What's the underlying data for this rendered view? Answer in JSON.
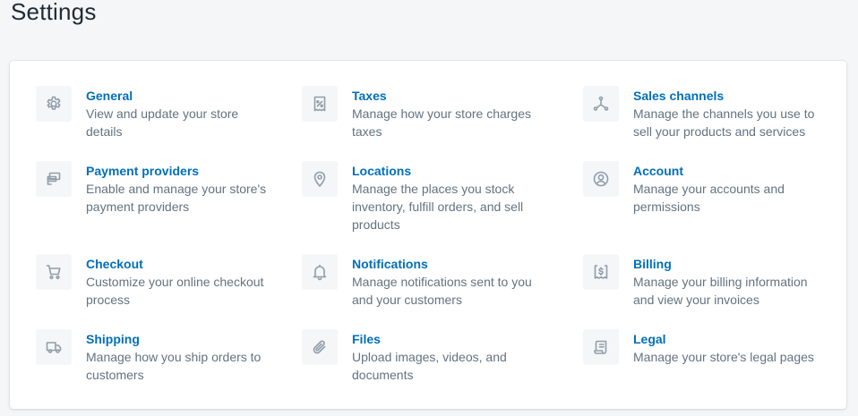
{
  "page": {
    "title": "Settings"
  },
  "settings": {
    "general": {
      "title": "General",
      "description": "View and update your store details",
      "icon": "gear-icon"
    },
    "taxes": {
      "title": "Taxes",
      "description": "Manage how your store charges taxes",
      "icon": "tax-icon"
    },
    "sales_channels": {
      "title": "Sales channels",
      "description": "Manage the channels you use to sell your products and services",
      "icon": "sales-channels-icon"
    },
    "payment_providers": {
      "title": "Payment providers",
      "description": "Enable and manage your store's payment providers",
      "icon": "payment-icon"
    },
    "locations": {
      "title": "Locations",
      "description": "Manage the places you stock inventory, fulfill orders, and sell products",
      "icon": "location-pin-icon"
    },
    "account": {
      "title": "Account",
      "description": "Manage your accounts and permissions",
      "icon": "account-icon"
    },
    "checkout": {
      "title": "Checkout",
      "description": "Customize your online checkout process",
      "icon": "cart-icon"
    },
    "notifications": {
      "title": "Notifications",
      "description": "Manage notifications sent to you and your customers",
      "icon": "bell-icon"
    },
    "billing": {
      "title": "Billing",
      "description": "Manage your billing information and view your invoices",
      "icon": "billing-icon"
    },
    "shipping": {
      "title": "Shipping",
      "description": "Manage how you ship orders to customers",
      "icon": "truck-icon"
    },
    "files": {
      "title": "Files",
      "description": "Upload images, videos, and documents",
      "icon": "paperclip-icon"
    },
    "legal": {
      "title": "Legal",
      "description": "Manage your store's legal pages",
      "icon": "legal-document-icon"
    }
  },
  "colors": {
    "link": "#006fbb",
    "description": "#637381",
    "icon": "#919eab",
    "page_background": "#f4f6f8"
  }
}
